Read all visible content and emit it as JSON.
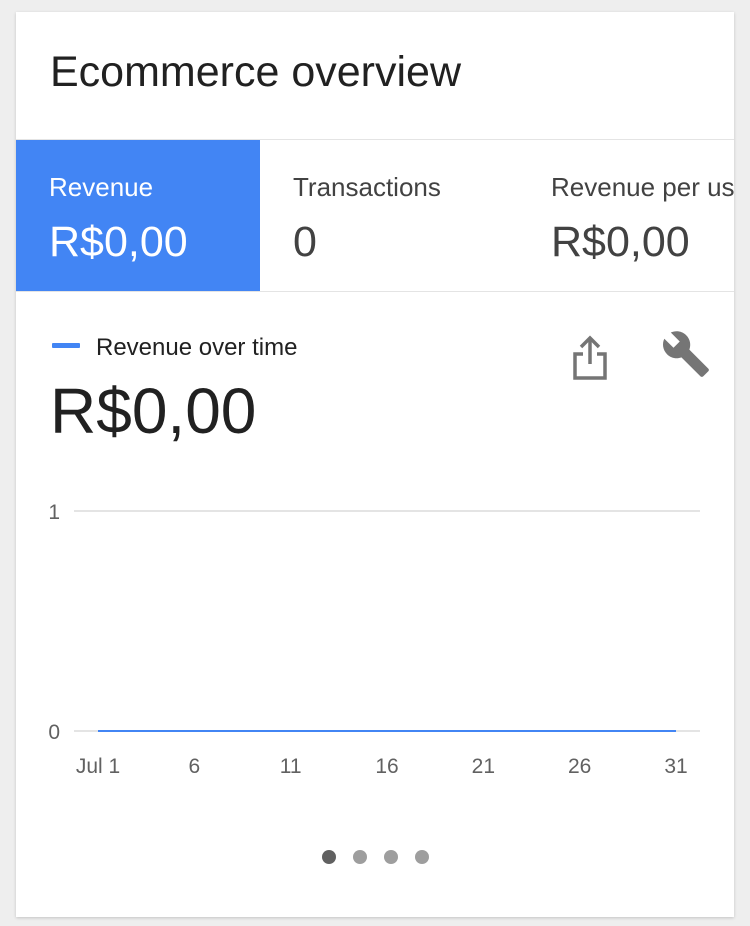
{
  "card": {
    "title": "Ecommerce overview"
  },
  "metrics": [
    {
      "label": "Revenue",
      "value": "R$0,00",
      "active": true
    },
    {
      "label": "Transactions",
      "value": "0",
      "active": false
    },
    {
      "label": "Revenue per us",
      "value": "R$0,00",
      "active": false
    }
  ],
  "chart_header": {
    "legend_label": "Revenue over time",
    "total_value": "R$0,00",
    "share_icon": "share-icon",
    "settings_icon": "wrench-icon"
  },
  "colors": {
    "accent": "#4285f4",
    "gridline": "#dcdcdc",
    "tick_text": "#616161"
  },
  "chart_data": {
    "type": "line",
    "x": [
      1,
      2,
      3,
      4,
      5,
      6,
      7,
      8,
      9,
      10,
      11,
      12,
      13,
      14,
      15,
      16,
      17,
      18,
      19,
      20,
      21,
      22,
      23,
      24,
      25,
      26,
      27,
      28,
      29,
      30,
      31
    ],
    "x_tick_values": [
      1,
      6,
      11,
      16,
      21,
      26,
      31
    ],
    "x_tick_labels": [
      "Jul 1",
      "6",
      "11",
      "16",
      "21",
      "26",
      "31"
    ],
    "y_tick_values": [
      0,
      1
    ],
    "y_tick_labels": [
      "0",
      "1"
    ],
    "series": [
      {
        "values": [
          0,
          0,
          0,
          0,
          0,
          0,
          0,
          0,
          0,
          0,
          0,
          0,
          0,
          0,
          0,
          0,
          0,
          0,
          0,
          0,
          0,
          0,
          0,
          0,
          0,
          0,
          0,
          0,
          0,
          0,
          0
        ]
      }
    ],
    "ylim": [
      0,
      1
    ],
    "xlim": [
      1,
      31
    ],
    "grid": true
  },
  "pagination": {
    "page_count": 4,
    "current": 0
  }
}
